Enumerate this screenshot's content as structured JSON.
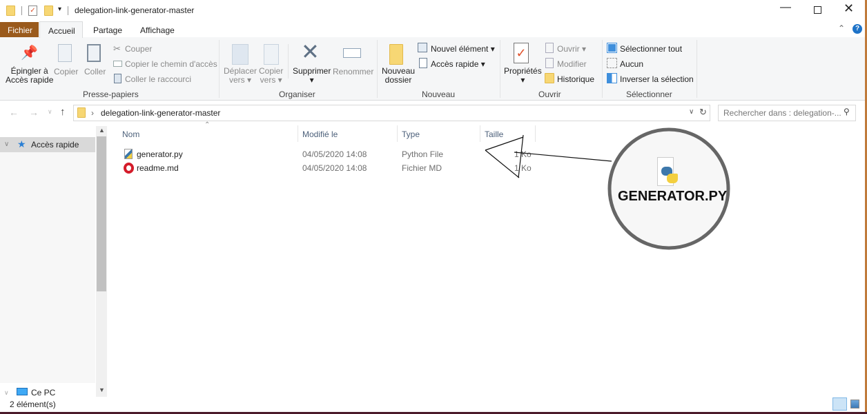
{
  "window": {
    "title": "delegation-link-generator-master",
    "controls": [
      "minimize",
      "maximize",
      "close"
    ]
  },
  "tabs": [
    {
      "label": "Fichier",
      "active": false
    },
    {
      "label": "Accueil",
      "active": true
    },
    {
      "label": "Partage",
      "active": false
    },
    {
      "label": "Affichage",
      "active": false
    }
  ],
  "ribbon": {
    "presse": {
      "group": "Presse-papiers",
      "pin": "Épingler à\nAccès rapide",
      "pin1": "Épingler à",
      "pin2": "Accès rapide",
      "copy": "Copier",
      "paste": "Coller",
      "cut": "Couper",
      "copy_path": "Copier le chemin d'accès",
      "paste_shortcut": "Coller le raccourci"
    },
    "organiser": {
      "group": "Organiser",
      "move1": "Déplacer",
      "move2": "vers",
      "copyto1": "Copier",
      "copyto2": "vers",
      "delete": "Supprimer",
      "rename": "Renommer"
    },
    "nouveau": {
      "group": "Nouveau",
      "new_folder1": "Nouveau",
      "new_folder2": "dossier",
      "new_item": "Nouvel élément",
      "easy_access": "Accès rapide"
    },
    "ouvrir": {
      "group": "Ouvrir",
      "properties": "Propriétés",
      "open": "Ouvrir",
      "edit": "Modifier",
      "history": "Historique"
    },
    "selectionner": {
      "group": "Sélectionner",
      "all": "Sélectionner tout",
      "none": "Aucun",
      "invert": "Inverser la sélection"
    }
  },
  "address": {
    "path": "delegation-link-generator-master",
    "search_placeholder": "Rechercher dans : delegation-..."
  },
  "nav": {
    "quick_access": "Accès rapide",
    "this_pc": "Ce PC"
  },
  "columns": [
    "Nom",
    "Modifié le",
    "Type",
    "Taille"
  ],
  "files": [
    {
      "name": "generator.py",
      "modified": "04/05/2020 14:08",
      "type": "Python File",
      "size": "1 Ko",
      "icon": "python-file-icon"
    },
    {
      "name": "readme.md",
      "modified": "04/05/2020 14:08",
      "type": "Fichier MD",
      "size": "1 Ko",
      "icon": "opera-icon"
    }
  ],
  "callout": {
    "label": "GENERATOR.PY"
  },
  "status": {
    "count": "2 élément(s)"
  }
}
